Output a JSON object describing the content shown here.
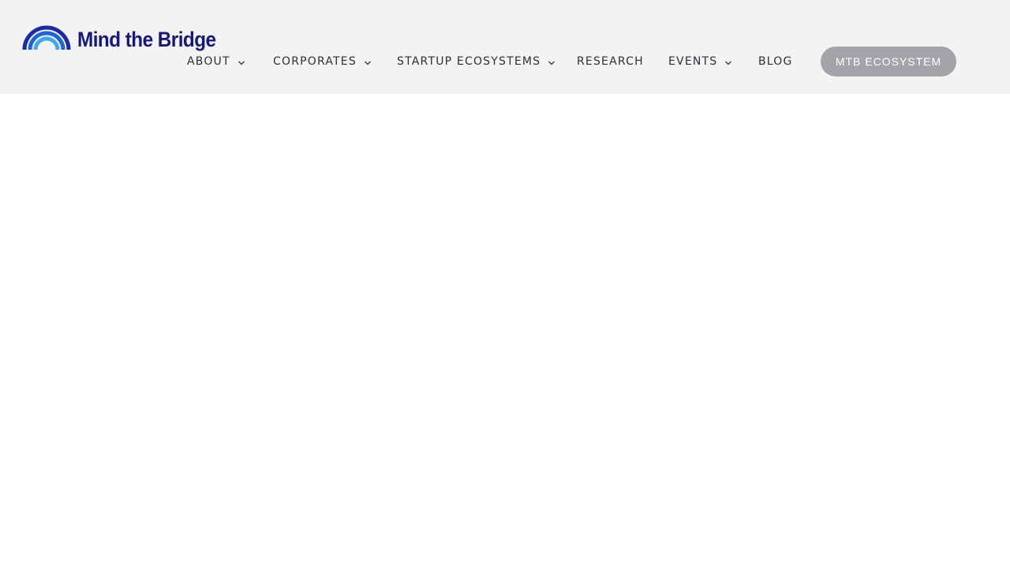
{
  "header": {
    "logo": {
      "text": "Mind the Bridge",
      "icon": "rainbow-arcs-logo-icon",
      "colors": {
        "outer_arc": "#1a2aa8",
        "middle_arc": "#1f64d8",
        "inner_arc": "#3ea9f2",
        "wordmark": "#16187a"
      }
    },
    "nav": {
      "items": [
        {
          "label": "ABOUT",
          "has_dropdown": true
        },
        {
          "label": "CORPORATES",
          "has_dropdown": true
        },
        {
          "label": "STARTUP ECOSYSTEMS",
          "has_dropdown": true
        },
        {
          "label": "RESEARCH",
          "has_dropdown": false
        },
        {
          "label": "EVENTS",
          "has_dropdown": true
        },
        {
          "label": "BLOG",
          "has_dropdown": false
        }
      ],
      "dropdown_icon": "chevron-down-icon"
    },
    "cta": {
      "label": "MTB ECOSYSTEM",
      "color": "#a3a4a9"
    },
    "background": "#f3f3f3"
  }
}
